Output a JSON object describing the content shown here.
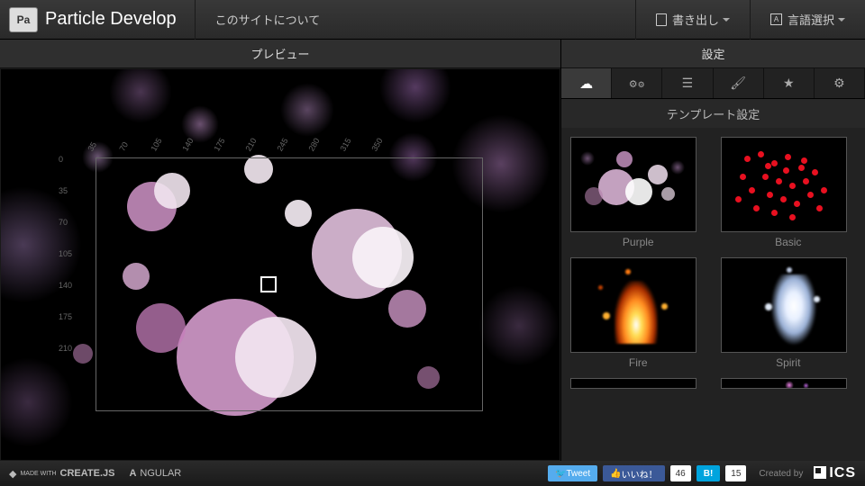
{
  "header": {
    "logo_abbr": "Pa",
    "app_title": "Particle Develop",
    "about": "このサイトについて",
    "export": "書き出し",
    "language": "言語選択"
  },
  "preview": {
    "title": "プレビュー",
    "ruler_h": [
      "35",
      "70",
      "105",
      "140",
      "175",
      "210",
      "245",
      "280",
      "315",
      "350"
    ],
    "ruler_v": [
      "0",
      "35",
      "70",
      "105",
      "140",
      "175",
      "210"
    ]
  },
  "settings": {
    "title": "設定",
    "sub_title": "テンプレート設定",
    "tabs": [
      {
        "name": "template-tab",
        "icon": "cloud"
      },
      {
        "name": "emitter-tab",
        "icon": "gears"
      },
      {
        "name": "params-tab",
        "icon": "sliders"
      },
      {
        "name": "color-tab",
        "icon": "brush"
      },
      {
        "name": "shape-tab",
        "icon": "star"
      },
      {
        "name": "canvas-tab",
        "icon": "gear"
      }
    ],
    "templates": [
      {
        "id": "purple",
        "label": "Purple"
      },
      {
        "id": "basic",
        "label": "Basic"
      },
      {
        "id": "fire",
        "label": "Fire"
      },
      {
        "id": "spirit",
        "label": "Spirit"
      }
    ]
  },
  "footer": {
    "made_with_createjs": "CREATE.JS",
    "angular": "NGULAR",
    "tweet": "Tweet",
    "like": "いいね！",
    "like_count": "46",
    "hatena_count": "15",
    "created_by": "Created by",
    "brand": "ICS"
  }
}
